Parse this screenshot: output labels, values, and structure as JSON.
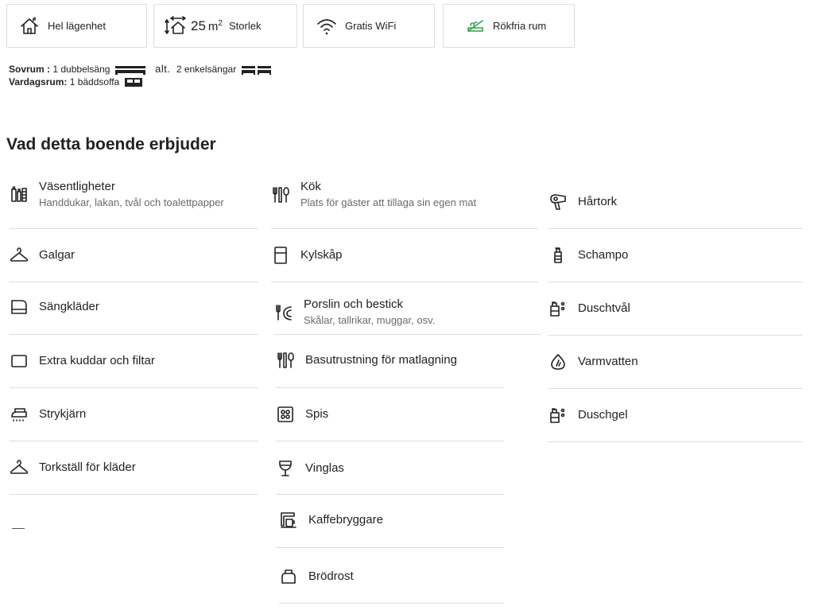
{
  "features": [
    {
      "label": "Hel lägenhet",
      "icon": "home-icon"
    },
    {
      "size_value": "25",
      "size_unit": "m",
      "size_exp": "2",
      "label": "Storlek",
      "icon": "size-icon"
    },
    {
      "label": "Gratis WiFi",
      "icon": "wifi-icon"
    },
    {
      "label": "Rökfria rum",
      "icon": "no-smoking-icon",
      "icon_color": "#2fa24a"
    }
  ],
  "rooms": {
    "bedroom_label": "Sovrum :",
    "bedroom_value": "1 dubbelsäng",
    "alt": "alt.",
    "bedroom_alt_value": "2 enkelsängar",
    "living_label": "Vardagsrum:",
    "living_value": "1 bäddsoffa"
  },
  "heading": "Vad detta boende erbjuder",
  "amenities": {
    "col1": [
      {
        "name": "Väsentligheter",
        "sub": "Handdukar, lakan, tvål och toalettpapper",
        "icon": "essentials-icon"
      },
      {
        "name": "Galgar",
        "icon": "hanger-icon"
      },
      {
        "name": "Sängkläder",
        "icon": "bed-linen-icon"
      },
      {
        "name": "Extra kuddar och filtar",
        "icon": "pillow-icon"
      },
      {
        "name": "Strykjärn",
        "icon": "iron-icon"
      },
      {
        "name": "Torkställ för kläder",
        "icon": "drying-rack-icon"
      }
    ],
    "col2": [
      {
        "name": "Kök",
        "sub": "Plats för gäster att tillaga sin egen mat",
        "icon": "kitchen-icon"
      },
      {
        "name": "Kylskåp",
        "icon": "fridge-icon"
      },
      {
        "name": "Porslin och bestick",
        "sub": "Skålar, tallrikar, muggar, osv.",
        "icon": "dishes-icon"
      },
      {
        "name": "Basutrustning för matlagning",
        "icon": "cooking-basics-icon"
      },
      {
        "name": "Spis",
        "icon": "stove-icon"
      },
      {
        "name": "Vinglas",
        "icon": "wine-glass-icon"
      },
      {
        "name": "Kaffebryggare",
        "icon": "coffee-maker-icon"
      },
      {
        "name": "Brödrost",
        "icon": "toaster-icon"
      }
    ],
    "col3": [
      {
        "name": "Hårtork",
        "icon": "hair-dryer-icon"
      },
      {
        "name": "Schampo",
        "icon": "shampoo-icon"
      },
      {
        "name": "Duschtvål",
        "icon": "shower-soap-icon"
      },
      {
        "name": "Varmvatten",
        "icon": "hot-water-icon"
      },
      {
        "name": "Duschgel",
        "icon": "shower-gel-icon"
      }
    ]
  }
}
